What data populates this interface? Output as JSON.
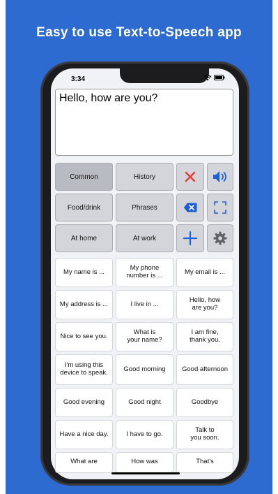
{
  "banner": {
    "headline": "Easy to use Text-to-Speech app"
  },
  "status_bar": {
    "time": "3:34",
    "icons": "wifi-icon battery-icon"
  },
  "input": {
    "text": "Hello, how are you?"
  },
  "categories": [
    {
      "label": "Common",
      "active": true
    },
    {
      "label": "History"
    },
    {
      "label": "Food/drink"
    },
    {
      "label": "Phrases"
    },
    {
      "label": "At home"
    },
    {
      "label": "At work"
    }
  ],
  "actions": [
    {
      "icon": "clear-x-icon",
      "color": "#e53935"
    },
    {
      "icon": "speaker-icon",
      "color": "#1f5fd6"
    },
    {
      "icon": "backspace-icon",
      "color": "#1f5fd6"
    },
    {
      "icon": "fullscreen-icon",
      "color": "#1f5fd6"
    },
    {
      "icon": "add-plus-icon",
      "color": "#1f5fd6"
    },
    {
      "icon": "gear-icon",
      "color": "#5f6368"
    }
  ],
  "phrases": [
    "My name is ...",
    "My phone\nnumber is ...",
    "My email is ...",
    "My address is ...",
    "I live in ...",
    "Hello, how\nare you?",
    "Nice to see you.",
    "What is\nyour name?",
    "I am fine,\nthank you.",
    "I'm using this\ndevice to speak.",
    "Good morning",
    "Good afternoon",
    "Good evening",
    "Good night",
    "Goodbye",
    "Have a nice day.",
    "I have to go.",
    "Talk to\nyou soon.",
    "What are",
    "How was",
    "That's"
  ]
}
